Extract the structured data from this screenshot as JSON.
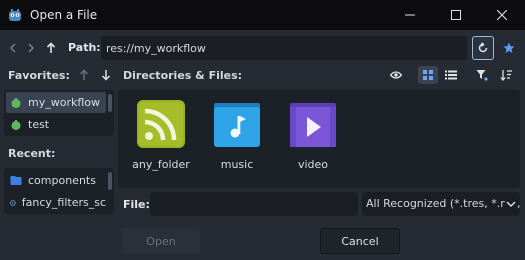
{
  "window": {
    "title": "Open a File"
  },
  "toolbar": {
    "path_label": "Path:",
    "path_value": "res://my_workflow"
  },
  "favorites": {
    "title": "Favorites:",
    "items": [
      {
        "label": "my_workflow",
        "icon": "folder-green-icon",
        "selected": true
      },
      {
        "label": "test",
        "icon": "folder-green-icon",
        "selected": false
      }
    ]
  },
  "recent": {
    "title": "Recent:",
    "items": [
      {
        "label": "components",
        "icon": "folder-blue-icon"
      },
      {
        "label": "fancy_filters_sc",
        "icon": "resource-icon"
      }
    ]
  },
  "files": {
    "title": "Directories & Files:",
    "items": [
      {
        "name": "any_folder",
        "icon": "rss-folder-icon",
        "color": "#9ab320"
      },
      {
        "name": "music",
        "icon": "music-folder-icon",
        "color": "#2ea4e6"
      },
      {
        "name": "video",
        "icon": "video-folder-icon",
        "color": "#7b57d8"
      }
    ]
  },
  "file_row": {
    "label": "File:",
    "value": "",
    "filter": "All Recognized (*.tres, *.res,"
  },
  "buttons": {
    "open": "Open",
    "cancel": "Cancel"
  },
  "colors": {
    "accent": "#5b9cf6",
    "titlebar": "#0c0c0e",
    "panel": "#1c2027",
    "background": "#262b33"
  }
}
